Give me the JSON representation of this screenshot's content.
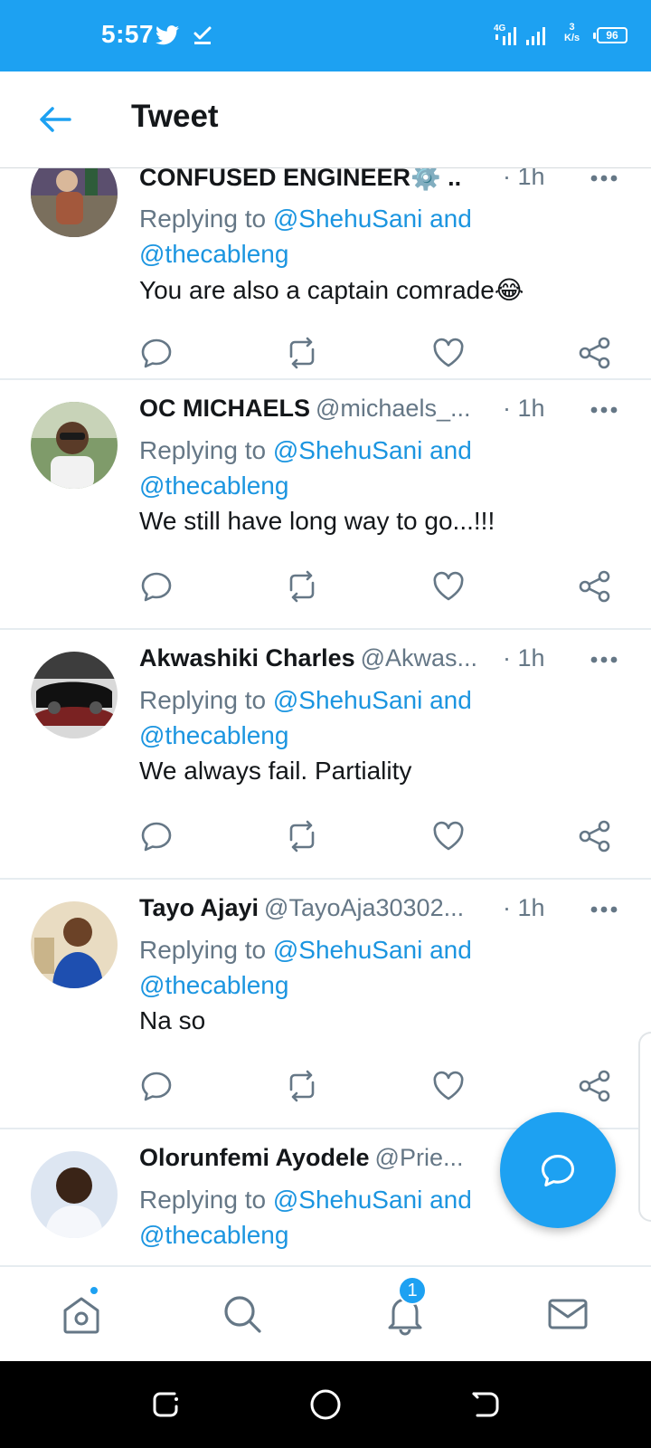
{
  "status_bar": {
    "time": "5:57",
    "net_speed_value": "3",
    "net_speed_unit": "K/s",
    "battery": "96",
    "network_type": "4G"
  },
  "header": {
    "title": "Tweet"
  },
  "tweets": [
    {
      "name": "CONFUSED ENGINEER⚙️ ..",
      "handle": "",
      "time": "· 1h",
      "reply_prefix": "Replying to ",
      "reply_to_1": "@ShehuSani and",
      "reply_to_2": "@thecableng",
      "text": "You are also a captain comrade😂"
    },
    {
      "name": "OC MICHAELS",
      "handle": "@michaels_...",
      "time": "· 1h",
      "reply_prefix": "Replying to ",
      "reply_to_1": "@ShehuSani and",
      "reply_to_2": "@thecableng",
      "text": "We still have long way to go...!!!"
    },
    {
      "name": "Akwashiki Charles",
      "handle": "@Akwas...",
      "time": "· 1h",
      "reply_prefix": "Replying to ",
      "reply_to_1": "@ShehuSani and",
      "reply_to_2": "@thecableng",
      "text": "We always fail. Partiality"
    },
    {
      "name": "Tayo Ajayi",
      "handle": "@TayoAja30302...",
      "time": "· 1h",
      "reply_prefix": "Replying to ",
      "reply_to_1": "@ShehuSani and",
      "reply_to_2": "@thecableng",
      "text": "Na so"
    },
    {
      "name": "Olorunfemi Ayodele",
      "handle": "@Prie...",
      "time": "",
      "reply_prefix": "Replying to ",
      "reply_to_1": "@ShehuSani and",
      "reply_to_2": "@thecableng",
      "text": ""
    }
  ],
  "bottom_nav": {
    "notifications_badge": "1",
    "items": [
      "home-icon",
      "search-icon",
      "notifications-icon",
      "messages-icon"
    ]
  },
  "colors": {
    "brand": "#1da1f2",
    "link": "#1b95e0",
    "muted": "#657786",
    "text": "#14171a"
  }
}
